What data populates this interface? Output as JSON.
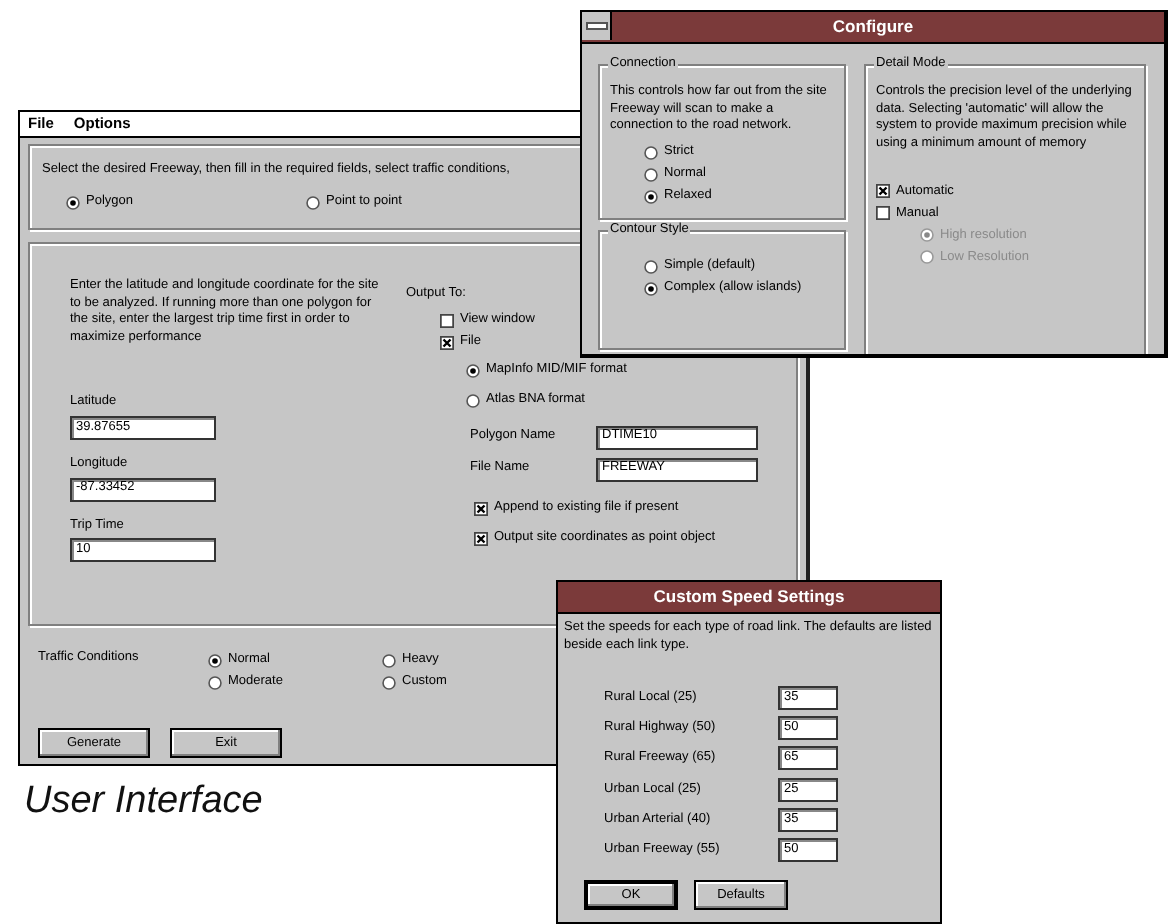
{
  "caption": "User Interface",
  "main_window": {
    "menu": [
      {
        "label": "File"
      },
      {
        "label": "Options"
      }
    ],
    "instructions": "Select the desired Freeway, then fill in the required fields, select traffic conditions,",
    "mode_options": [
      {
        "label": "Polygon",
        "selected": true
      },
      {
        "label": "Point to point",
        "selected": false
      }
    ],
    "description": "Enter the latitude and longitude coordinate for the site to be analyzed.   If running more than one polygon for the site, enter the largest trip time first in order to maximize performance",
    "output_label": "Output To:",
    "output_checks": [
      {
        "label": "View window",
        "checked": false
      },
      {
        "label": "File",
        "checked": true
      }
    ],
    "format_options": [
      {
        "label": "MapInfo MID/MIF format",
        "selected": true
      },
      {
        "label": "Atlas BNA format",
        "selected": false
      }
    ],
    "coordinate_fields": [
      {
        "label": "Latitude",
        "value": "39.87655"
      },
      {
        "label": "Longitude",
        "value": "-87.33452"
      },
      {
        "label": "Trip Time",
        "value": "10"
      }
    ],
    "name_fields": [
      {
        "label": "Polygon Name",
        "value": "DTIME10"
      },
      {
        "label": "File Name",
        "value": "FREEWAY"
      }
    ],
    "file_checks": [
      {
        "label": "Append to existing file if present",
        "checked": true
      },
      {
        "label": "Output site coordinates as point object",
        "checked": true
      }
    ],
    "traffic_label": "Traffic Conditions",
    "traffic_options": [
      {
        "label": "Normal",
        "selected": true
      },
      {
        "label": "Moderate",
        "selected": false
      },
      {
        "label": "Heavy",
        "selected": false
      },
      {
        "label": "Custom",
        "selected": false
      }
    ],
    "buttons": [
      {
        "label": "Generate"
      },
      {
        "label": "Exit"
      }
    ]
  },
  "configure_window": {
    "title": "Configure",
    "connection": {
      "title": "Connection",
      "description": "This controls how far out from the site Freeway will scan to make a connection to the road network.",
      "options": [
        {
          "label": "Strict",
          "selected": false
        },
        {
          "label": "Normal",
          "selected": false
        },
        {
          "label": "Relaxed",
          "selected": true
        }
      ]
    },
    "contour_style": {
      "title": "Contour Style",
      "options": [
        {
          "label": "Simple (default)",
          "selected": false
        },
        {
          "label": "Complex (allow islands)",
          "selected": true
        }
      ]
    },
    "detail_mode": {
      "title": "Detail Mode",
      "description": "Controls the precision level of the underlying data.   Selecting 'automatic' will allow the system to provide maximum precision while using a minimum amount of memory",
      "checks": [
        {
          "label": "Automatic",
          "checked": true
        },
        {
          "label": "Manual",
          "checked": false
        }
      ],
      "resolution_options": [
        {
          "label": "High resolution",
          "selected": true,
          "disabled": true
        },
        {
          "label": "Low Resolution",
          "selected": false,
          "disabled": true
        }
      ]
    }
  },
  "speed_window": {
    "title": "Custom Speed Settings",
    "description": "Set the speeds for each type of road link.   The defaults are listed beside each link type.",
    "road_groups": [
      {
        "rows": [
          {
            "label": "Rural Local (25)",
            "value": "35"
          },
          {
            "label": "Rural Highway (50)",
            "value": "50"
          },
          {
            "label": "Rural Freeway (65)",
            "value": "65"
          }
        ]
      },
      {
        "rows": [
          {
            "label": "Urban Local (25)",
            "value": "25"
          },
          {
            "label": "Urban Arterial (40)",
            "value": "35"
          },
          {
            "label": "Urban Freeway (55)",
            "value": "50"
          }
        ]
      }
    ],
    "buttons": [
      {
        "label": "OK",
        "default": true
      },
      {
        "label": "Defaults",
        "default": false
      }
    ]
  }
}
